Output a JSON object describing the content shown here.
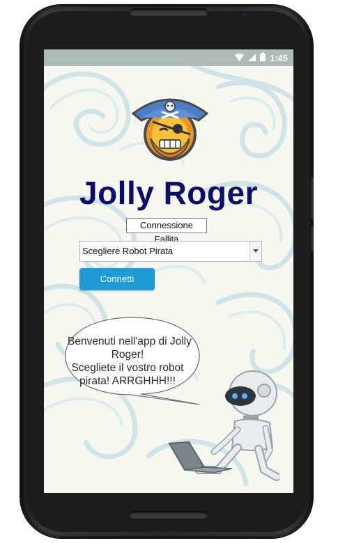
{
  "status_bar": {
    "time": "1:45",
    "icons": [
      "wifi-icon",
      "signal-icon",
      "battery-icon"
    ]
  },
  "app": {
    "title": "Jolly Roger",
    "connection_status": "Connessione Fallita",
    "robot_select": {
      "selected": "Scegliere Robot Pirata"
    },
    "connect_button": "Connetti",
    "speech_bubble": {
      "lines": [
        "Benvenuti nell'app di Jolly",
        "Roger!",
        "Scegliete il vostro robot",
        "pirata! ARRGHHH!!!"
      ]
    }
  },
  "colors": {
    "title": "#0c0c6b",
    "button": "#1e9ad6",
    "status_bar": "#aebbb6",
    "background_swirl": "#cfe4e6"
  }
}
